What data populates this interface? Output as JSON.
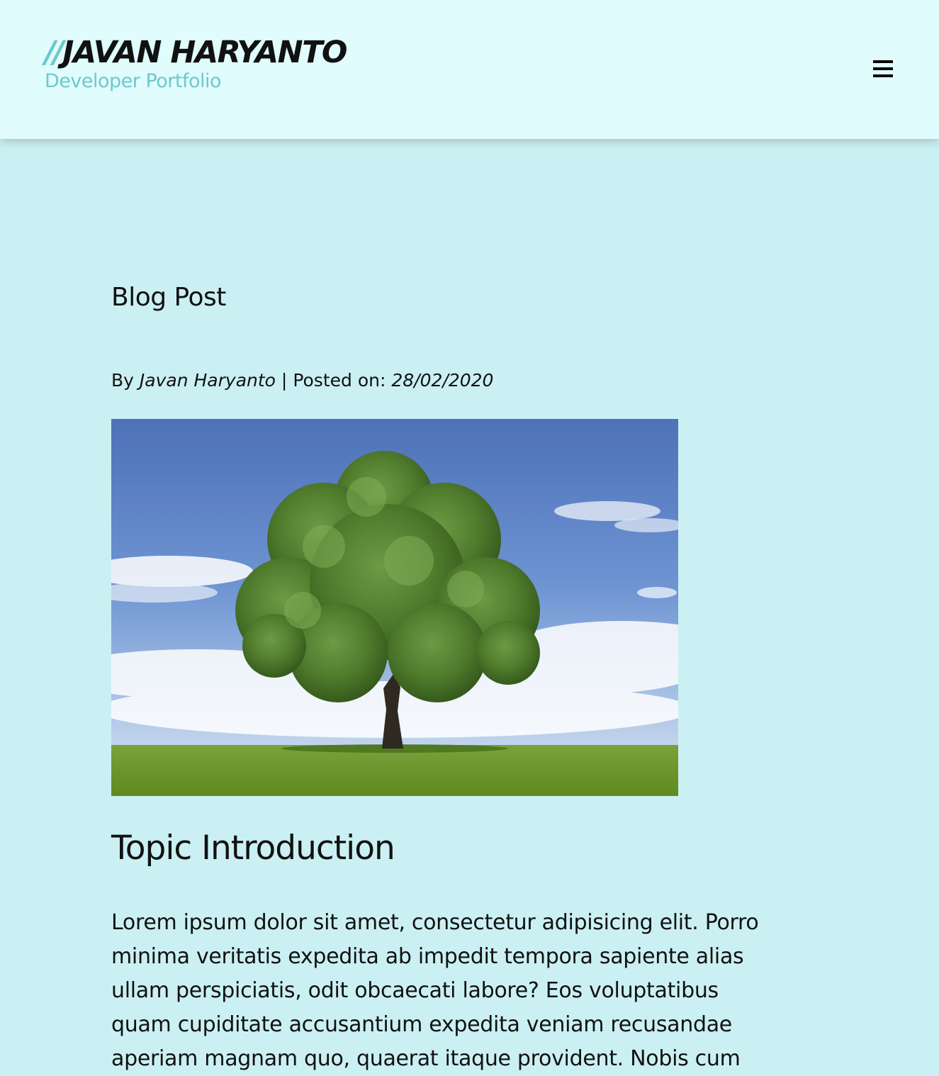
{
  "header": {
    "brand_slash": "//",
    "brand_name": "JAVAN HARYANTO",
    "tagline": "Developer Portfolio",
    "menu_icon": "hamburger-menu-icon",
    "accent_color": "#6ec8cd",
    "background_color": "#e0fcfd"
  },
  "page": {
    "background_color": "#cbf0f3",
    "heading": "Blog Post"
  },
  "post": {
    "by_label": "By",
    "author": "Javan Haryanto",
    "separator": "|",
    "posted_label": "Posted on:",
    "date": "28/02/2020",
    "image_alt": "tree-in-field-image",
    "topic_title": "Topic Introduction",
    "body_lines": [
      "Lorem ipsum dolor sit amet, consectetur adipisicing elit. Porro",
      "minima veritatis expedita ab impedit tempora sapiente alias",
      "ullam perspiciatis, odit obcaecati labore? Eos voluptatibus",
      "quam cupiditate accusantium expedita veniam recusandae",
      "aperiam magnam quo, quaerat itaque provident. Nobis cum"
    ]
  }
}
